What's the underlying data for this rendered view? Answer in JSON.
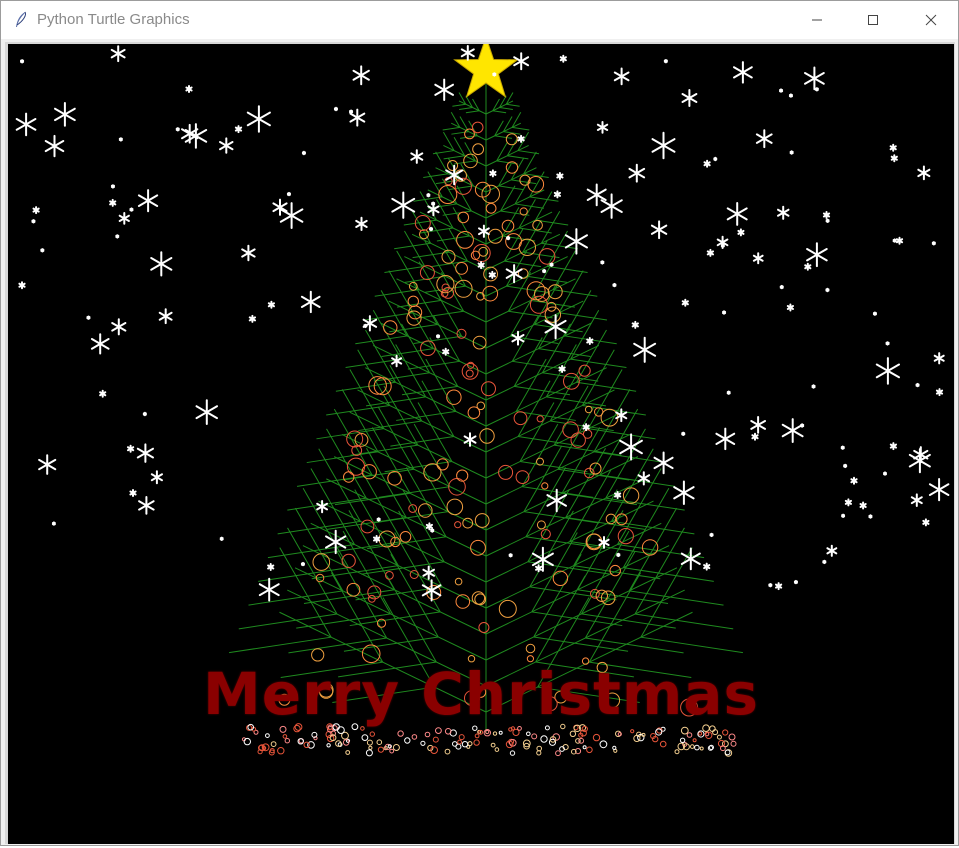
{
  "window": {
    "title": "Python Turtle Graphics",
    "icon": "feather-icon",
    "controls": [
      "minimize-icon",
      "maximize-icon",
      "close-icon"
    ]
  },
  "canvas": {
    "background": "#000000",
    "greeting": "Merry Christmas",
    "greeting_color": "#8a0000",
    "star_color": "#ffe600",
    "branch_color": "#1f8a1f",
    "ornament_colors": [
      "#e8553a",
      "#ff8a3d",
      "#f0a040"
    ],
    "snow_color": "#ffffff"
  }
}
